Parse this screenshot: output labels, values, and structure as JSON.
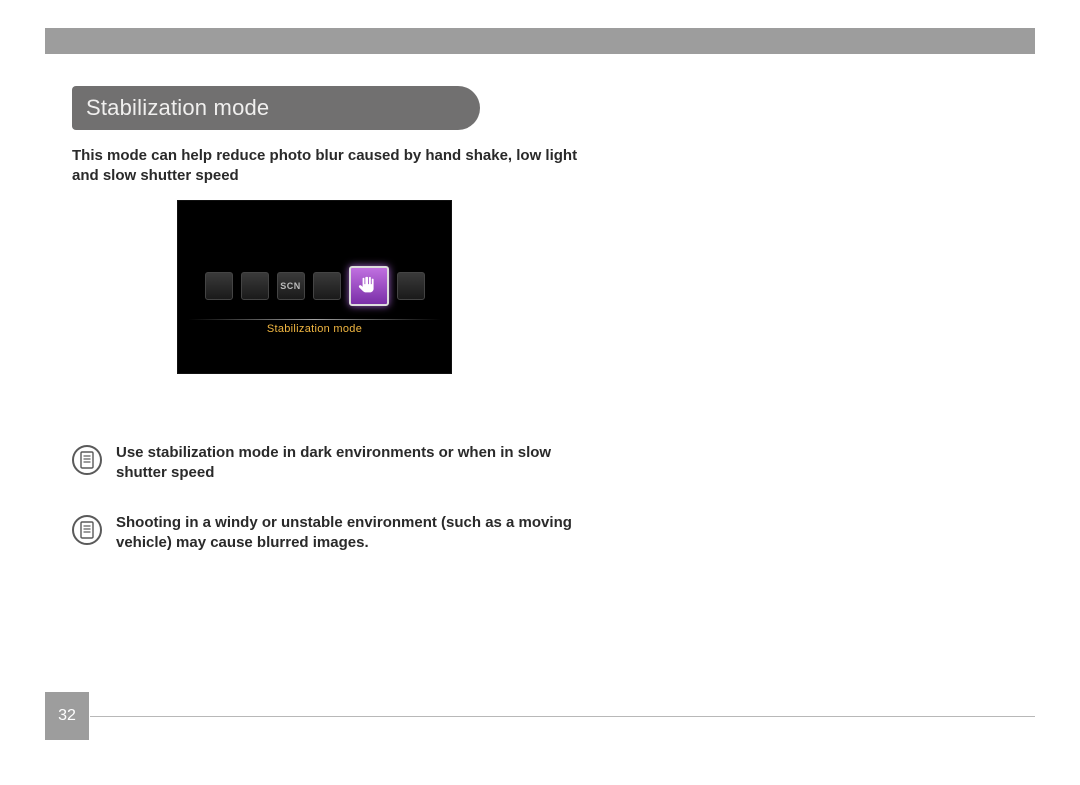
{
  "heading": "Stabilization mode",
  "intro": "This mode can help reduce photo blur caused by hand shake, low light and slow shutter speed",
  "screenshot": {
    "label": "Stabilization mode",
    "mode_text": "SCN"
  },
  "notes": [
    "Use stabilization mode in dark environments or when in slow shutter speed",
    "Shooting in a windy or unstable environment (such as a moving vehicle) may cause blurred images."
  ],
  "page_number": "32"
}
